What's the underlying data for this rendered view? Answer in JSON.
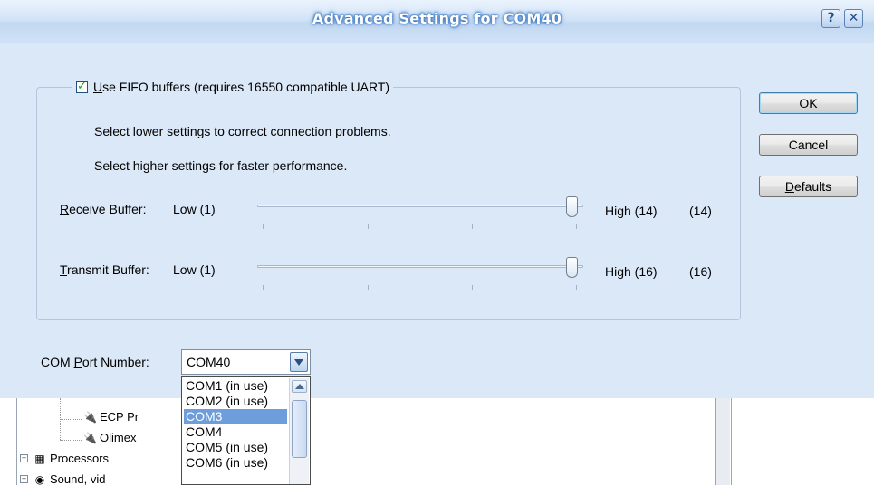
{
  "window": {
    "title": "Advanced Settings for COM40",
    "help_glyph": "?",
    "close_glyph": "✕"
  },
  "fifo": {
    "checkbox_checked": true,
    "label_prefix": "",
    "label_accel": "U",
    "label_rest": "se FIFO buffers (requires 16550 compatible UART)"
  },
  "hints": {
    "line1": "Select lower settings to correct connection problems.",
    "line2": "Select higher settings for faster performance."
  },
  "receive": {
    "label_accel": "R",
    "label_rest": "eceive Buffer:",
    "low": "Low (1)",
    "high": "High (14)",
    "value": "(14)",
    "level_fraction": 1.0
  },
  "transmit": {
    "label_accel": "T",
    "label_rest": "ransmit Buffer:",
    "low": "Low (1)",
    "high": "High (16)",
    "value": "(16)",
    "level_fraction": 1.0
  },
  "buttons": {
    "ok": "OK",
    "cancel": "Cancel",
    "defaults_accel": "D",
    "defaults_rest": "efaults"
  },
  "com_port": {
    "label_prefix": "COM ",
    "label_accel": "P",
    "label_rest": "ort Number:",
    "selected_value": "COM40"
  },
  "dropdown": {
    "items": [
      "COM1 (in use)",
      "COM2 (in use)",
      "COM3",
      "COM4",
      "COM5 (in use)",
      "COM6 (in use)"
    ],
    "highlighted": "COM3"
  },
  "tree": {
    "items": [
      "ECP Pr",
      "Olimex",
      "Processors",
      "Sound, vid"
    ]
  },
  "colors": {
    "dialog_bg": "#dbe8f7",
    "selection": "#6d9edb",
    "checkmark": "#21a121"
  }
}
